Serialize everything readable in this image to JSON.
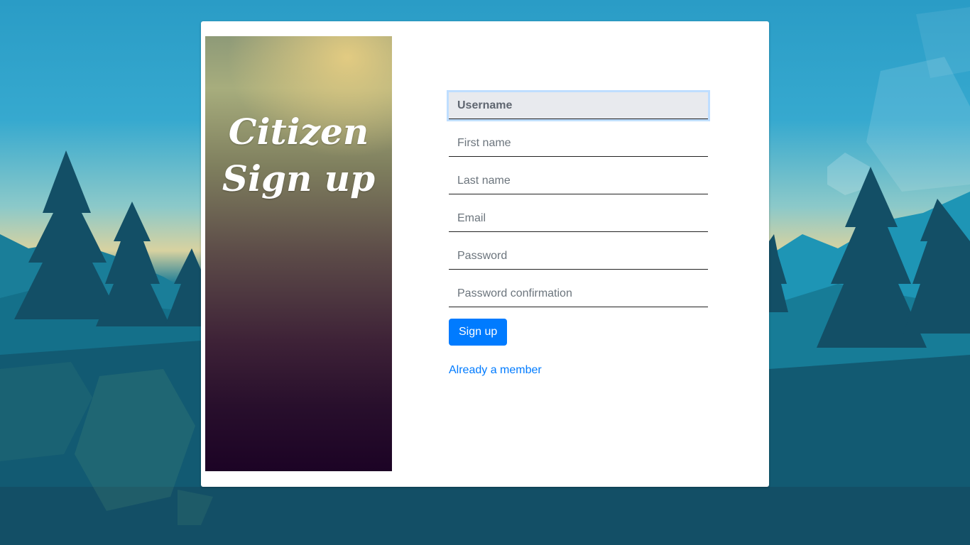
{
  "sidebar": {
    "title_line1": "Citizen",
    "title_line2": "Sign up"
  },
  "form": {
    "username_placeholder": "Username",
    "first_name_placeholder": "First name",
    "last_name_placeholder": "Last name",
    "email_placeholder": "Email",
    "password_placeholder": "Password",
    "password_confirmation_placeholder": "Password confirmation",
    "submit_label": "Sign up",
    "login_link": "Already a member"
  },
  "colors": {
    "accent": "#007bff",
    "background_sky": "#2a9cc6",
    "background_forest": "#134f66"
  }
}
